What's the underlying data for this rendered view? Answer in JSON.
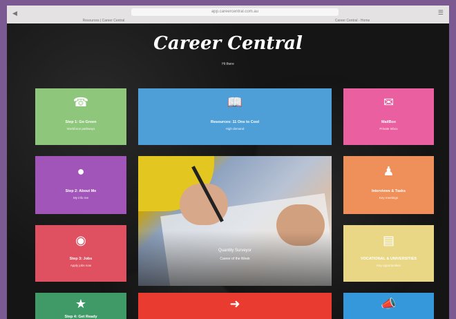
{
  "browser": {
    "url": "app.careercentral.com.au",
    "tabs": [
      "Resources | Career Central",
      "",
      "Career Central - Home"
    ]
  },
  "header": {
    "title": "Career Central",
    "subtitle": "Hi there"
  },
  "tiles": {
    "step1": {
      "title": "Step 1: Go Green",
      "subtitle": "Workforce pathways",
      "icon": "phone-icon",
      "color": "#8ec77b"
    },
    "resources": {
      "title": "Resources: 11 Ons to Cool",
      "subtitle": "High demand",
      "icon": "book-icon",
      "color": "#4e9fd8"
    },
    "mailbox": {
      "title": "MailBox",
      "subtitle": "Private Inbox",
      "icon": "mail-icon",
      "color": "#ea5fa0"
    },
    "step2": {
      "title": "Step 2: About Me",
      "subtitle": "My info me",
      "icon": "person-icon",
      "color": "#a155b9"
    },
    "interviews": {
      "title": "Interviews & Tasks",
      "subtitle": "Key meetings",
      "icon": "group-icon",
      "color": "#ef8f5a"
    },
    "step3": {
      "title": "Step 3: Jobs",
      "subtitle": "Apply jobs now",
      "icon": "binoculars-icon",
      "color": "#df5160"
    },
    "vocational": {
      "title": "VOCATIONAL & UNIVERSITIES",
      "subtitle": "Key opportunities",
      "icon": "bus-icon",
      "color": "#ead785"
    },
    "step4": {
      "title": "Step 4: Get Ready",
      "subtitle": "",
      "icon": "star-icon",
      "color": "#3f9a67"
    },
    "logout": {
      "title": "",
      "subtitle": "",
      "icon": "sign-out-icon",
      "color": "#ea3b30"
    },
    "news": {
      "title": "",
      "subtitle": "",
      "icon": "megaphone-icon",
      "color": "#3498da"
    }
  },
  "feature": {
    "caption_title": "Quantity Surveyor",
    "caption_sub": "Career of the Week"
  }
}
